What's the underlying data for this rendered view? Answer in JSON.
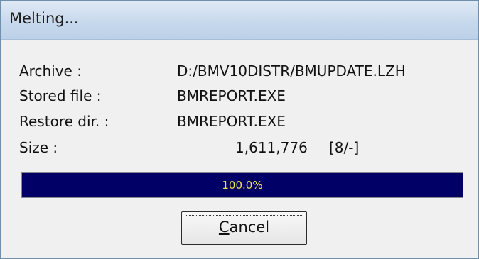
{
  "window": {
    "title": "Melting..."
  },
  "fields": {
    "archive": {
      "label": "Archive    :",
      "value": "D:/BMV10DISTR/BMUPDATE.LZH"
    },
    "stored_file": {
      "label": "Stored file :",
      "value": "BMREPORT.EXE"
    },
    "restore_dir": {
      "label": "Restore dir. :",
      "value": "BMREPORT.EXE"
    },
    "size": {
      "label": "Size       :",
      "value": "1,611,776",
      "extra": "[8/-]"
    }
  },
  "progress": {
    "percent": 100,
    "text": "100.0%",
    "fill_color": "#000066",
    "text_color": "#f0e64a"
  },
  "buttons": {
    "cancel": {
      "label": "Cancel",
      "mnemonic": "C"
    }
  }
}
